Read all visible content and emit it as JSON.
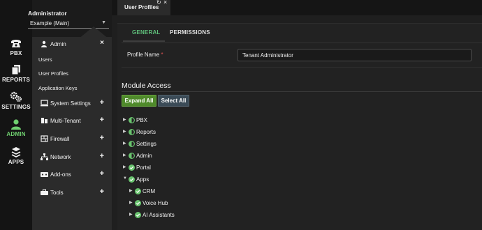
{
  "account": {
    "name": "Administrator",
    "tenant": "Example (Main)"
  },
  "rail": [
    {
      "label": "PBX",
      "icon": "phone-icon"
    },
    {
      "label": "REPORTS",
      "icon": "reports-icon"
    },
    {
      "label": "SETTINGS",
      "icon": "gears-icon"
    },
    {
      "label": "ADMIN",
      "icon": "user-icon",
      "active": true
    },
    {
      "label": "APPS",
      "icon": "apps-icon"
    }
  ],
  "submenu": {
    "header": "Admin",
    "links": [
      "Users",
      "User Profiles",
      "Application Keys"
    ],
    "groups": [
      {
        "label": "System Settings",
        "icon": "monitor-icon"
      },
      {
        "label": "Multi-Tenant",
        "icon": "tenant-icon"
      },
      {
        "label": "Firewall",
        "icon": "firewall-icon"
      },
      {
        "label": "Network",
        "icon": "network-icon"
      },
      {
        "label": "Add-ons",
        "icon": "addons-icon"
      },
      {
        "label": "Tools",
        "icon": "tools-icon"
      }
    ]
  },
  "tab": {
    "label": "User Profiles"
  },
  "tabs": {
    "general": "GENERAL",
    "permissions": "PERMISSIONS"
  },
  "form": {
    "profile_label": "Profile Name",
    "required_mark": "*",
    "profile_value": "Tenant Administrator"
  },
  "module_access": {
    "title": "Module Access",
    "expand_all": "Expand All",
    "select_all": "Select All",
    "tree": [
      {
        "label": "PBX",
        "state": "partial",
        "expanded": false,
        "level": 0
      },
      {
        "label": "Reports",
        "state": "partial",
        "expanded": false,
        "level": 0
      },
      {
        "label": "Settings",
        "state": "partial",
        "expanded": false,
        "level": 0
      },
      {
        "label": "Admin",
        "state": "partial",
        "expanded": false,
        "level": 0
      },
      {
        "label": "Portal",
        "state": "full",
        "expanded": false,
        "level": 0
      },
      {
        "label": "Apps",
        "state": "full",
        "expanded": true,
        "level": 0
      },
      {
        "label": "CRM",
        "state": "full",
        "expanded": false,
        "level": 1
      },
      {
        "label": "Voice Hub",
        "state": "full",
        "expanded": false,
        "level": 1
      },
      {
        "label": "AI Assistants",
        "state": "full",
        "expanded": false,
        "level": 1
      }
    ]
  },
  "colors": {
    "accent_green": "#5fbf7a",
    "check_green": "#6ac46f",
    "required_red": "#e05454"
  }
}
